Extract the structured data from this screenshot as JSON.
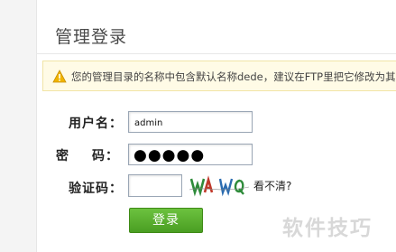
{
  "header": {
    "title": "管理登录"
  },
  "warning": {
    "icon": "warning-triangle-icon",
    "text": "您的管理目录的名称中包含默认名称dede，建议在FTP里把它修改为其"
  },
  "form": {
    "username_label": "用户名：",
    "password_label_left": "密",
    "password_label_right": "码：",
    "username_value": "admin",
    "password_mask": "●●●●●",
    "captcha_label": "验证码：",
    "captcha_value": "",
    "captcha_refresh_text": "看不清?",
    "submit_label": "登录"
  },
  "watermark": {
    "text": "软件技巧"
  },
  "colors": {
    "button_green": "#5aac2e",
    "warning_bg": "#fffbe6",
    "warning_icon": "#f0b400"
  }
}
